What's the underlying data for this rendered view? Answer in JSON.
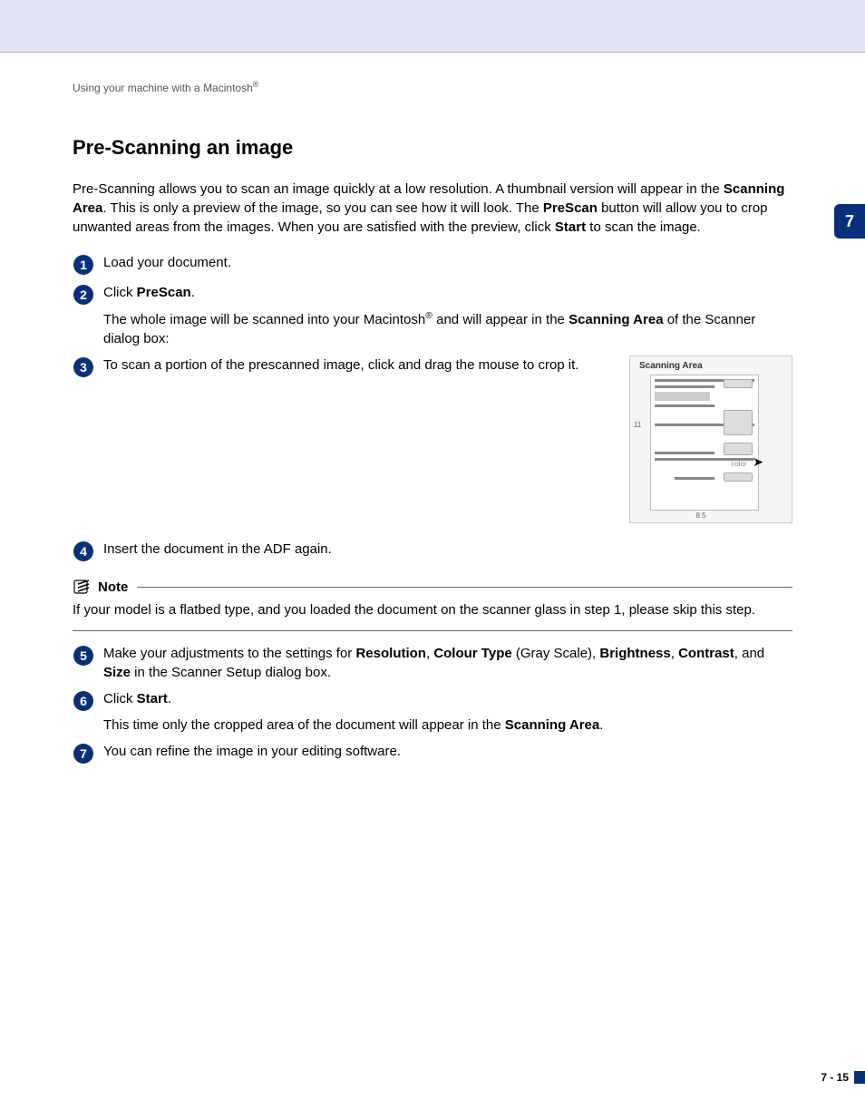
{
  "header": {
    "breadcrumb_pre": "Using your machine with a Macintosh",
    "breadcrumb_sup": "®"
  },
  "chapter_tab": "7",
  "title": "Pre-Scanning an image",
  "intro": {
    "p1a": "Pre-Scanning allows you to scan an image quickly at a low resolution. A thumbnail version will appear in the ",
    "p1b": "Scanning Area",
    "p1c": ". This is only a preview of the image, so you can see how it will look. The ",
    "p1d": "PreScan",
    "p1e": " button will allow you to crop unwanted areas from the images. When you are satisfied with the preview, click ",
    "p1f": "Start",
    "p1g": " to scan the image."
  },
  "steps": {
    "s1": {
      "num": "1",
      "text": "Load your document."
    },
    "s2": {
      "num": "2",
      "a": "Click ",
      "b": "PreScan",
      "c": ".",
      "extra_a": "The whole image will be scanned into your Macintosh",
      "extra_sup": "®",
      "extra_b": " and will appear in the ",
      "extra_c": "Scanning Area",
      "extra_d": " of the Scanner dialog box:"
    },
    "s3": {
      "num": "3",
      "text": "To scan a portion of the prescanned image, click and drag the mouse to crop it."
    },
    "s4": {
      "num": "4",
      "text": "Insert the document in the ADF again."
    },
    "s5": {
      "num": "5",
      "a": "Make your adjustments to the settings for ",
      "b1": "Resolution",
      "c1": ", ",
      "b2": "Colour Type",
      "c2": " (Gray Scale), ",
      "b3": "Brightness",
      "c3": ", ",
      "b4": "Contrast",
      "c4": ", and ",
      "b5": "Size",
      "c5": " in the Scanner Setup dialog box."
    },
    "s6": {
      "num": "6",
      "a": "Click ",
      "b": "Start",
      "c": ".",
      "extra_a": "This time only the cropped area of the document will appear in the ",
      "extra_b": "Scanning Area",
      "extra_c": "."
    },
    "s7": {
      "num": "7",
      "text": "You can refine the image in your editing software."
    }
  },
  "note": {
    "label": "Note",
    "body": "If your model is a flatbed type, and you loaded the document on the scanner glass in step 1, please skip this step."
  },
  "figure": {
    "title": "Scanning Area",
    "color_label": "color",
    "ruler_bottom": "8.5",
    "ruler_left": "11"
  },
  "footer": {
    "page": "7 - 15"
  }
}
